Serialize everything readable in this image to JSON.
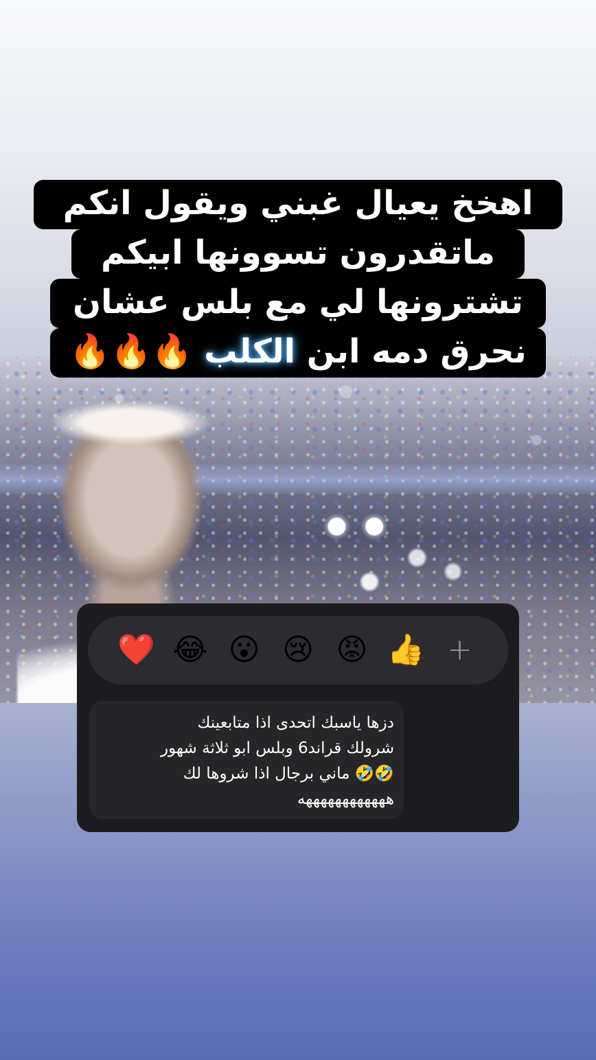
{
  "caption": {
    "line1": "اهخخ يعيال غبني ويقول انكم",
    "line2": "ماتقدرون تسوونها ابيكم",
    "line3": "تشترونها لي مع بلس عشان",
    "line4_start": "نحرق دمه ابن ",
    "line4_glow": "الكلب",
    "line4_end": " 🔥🔥🔥"
  },
  "reactions": {
    "heart": "❤️",
    "laugh": "😂",
    "wow": "😮",
    "sad": "😢",
    "angry": "😡",
    "thumbs_up": "👍",
    "more": "+"
  },
  "message": {
    "line1": "دزها ياسبك اتحدى اذا متابعينك",
    "line2": "شرولك قراند6 وبلس ابو ثلاثة شهور",
    "line3": "🤣🤣 ماني برجال اذا شروها لك",
    "line4": "ههههههههههههه"
  }
}
